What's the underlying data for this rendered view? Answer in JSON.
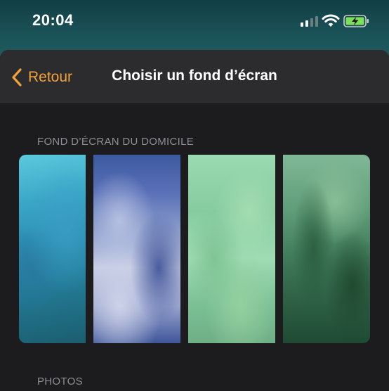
{
  "status_bar": {
    "time": "20:04",
    "icons": [
      "cellular-signal-icon",
      "wifi-icon",
      "battery-charging-icon"
    ]
  },
  "nav": {
    "back_label": "Retour",
    "title": "Choisir un fond d’écran"
  },
  "sections": {
    "home_header": "FOND D’ÉCRAN DU DOMICILE",
    "photos_header": "PHOTOS"
  },
  "wallpapers": [
    {
      "name": "wallpaper-blue"
    },
    {
      "name": "wallpaper-indigo"
    },
    {
      "name": "wallpaper-light-green"
    },
    {
      "name": "wallpaper-dark-green"
    }
  ],
  "colors": {
    "accent": "#f2a23a",
    "background": "#1c1c1e",
    "nav_background": "#2c2c2e",
    "section_text": "#8e8e93"
  }
}
